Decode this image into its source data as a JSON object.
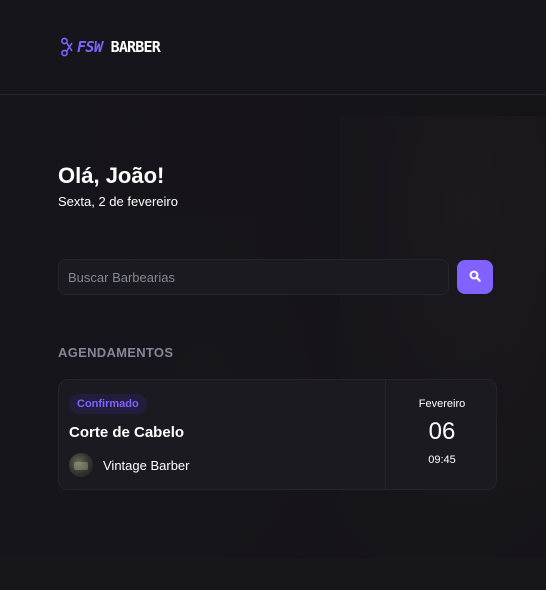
{
  "header": {
    "logo_prefix": "FSW",
    "logo_name": "BARBER",
    "logo_icon": "scissors-icon"
  },
  "greeting": {
    "hello": "Olá, ",
    "name": "João!",
    "date": "Sexta, 2 de fevereiro"
  },
  "search": {
    "placeholder": "Buscar Barbearias",
    "value": "",
    "button_icon": "search-icon"
  },
  "bookings": {
    "section_title": "AGENDAMENTOS",
    "items": [
      {
        "status": "Confirmado",
        "service": "Corte de Cabelo",
        "barbershop": "Vintage Barber",
        "month": "Fevereiro",
        "day": "06",
        "time": "09:45"
      }
    ]
  },
  "colors": {
    "primary": "#8162ff",
    "background": "#17161b",
    "card": "#1b1a20",
    "border": "#26252b",
    "muted_text": "#838896"
  }
}
